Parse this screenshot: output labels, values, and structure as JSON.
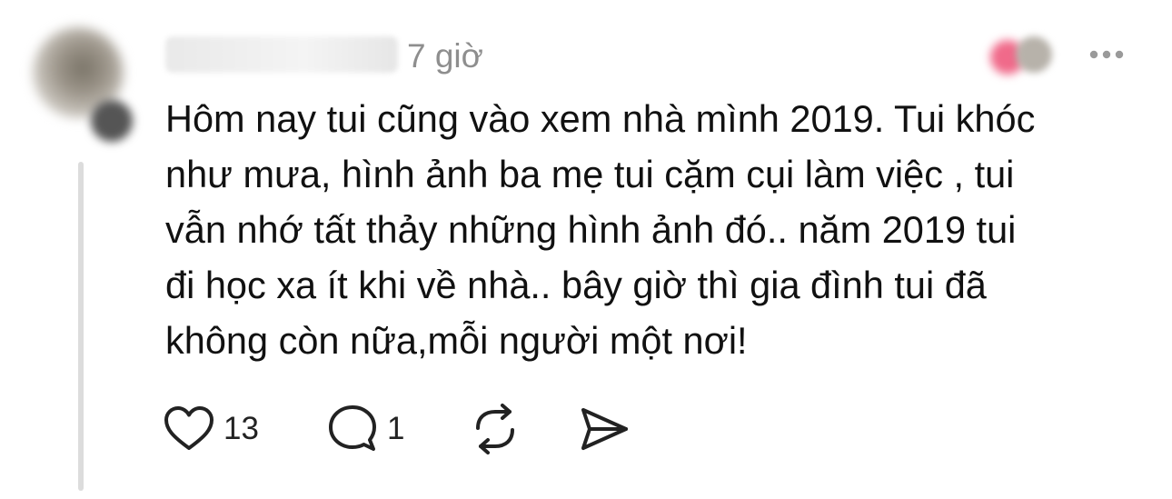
{
  "post": {
    "time": "7 giờ",
    "text": "Hôm nay tui cũng vào xem nhà mình 2019. Tui khóc\nnhư mưa, hình ảnh ba mẹ tui cặm cụi làm việc , tui\nvẫn nhớ tất thảy những hình ảnh đó.. năm 2019 tui\nđi học xa ít khi về nhà.. bây giờ thì gia đình tui đã\nkhông còn nữa,mỗi người một nơi!"
  },
  "actions": {
    "like_count": "13",
    "reply_count": "1"
  },
  "icons": {
    "like": "heart-icon",
    "reply": "comment-icon",
    "repost": "repost-icon",
    "share": "send-icon",
    "more": "more-horizontal-icon"
  },
  "colors": {
    "text": "#111111",
    "muted": "#8e8e8e",
    "thread_line": "#dcdcdc"
  }
}
